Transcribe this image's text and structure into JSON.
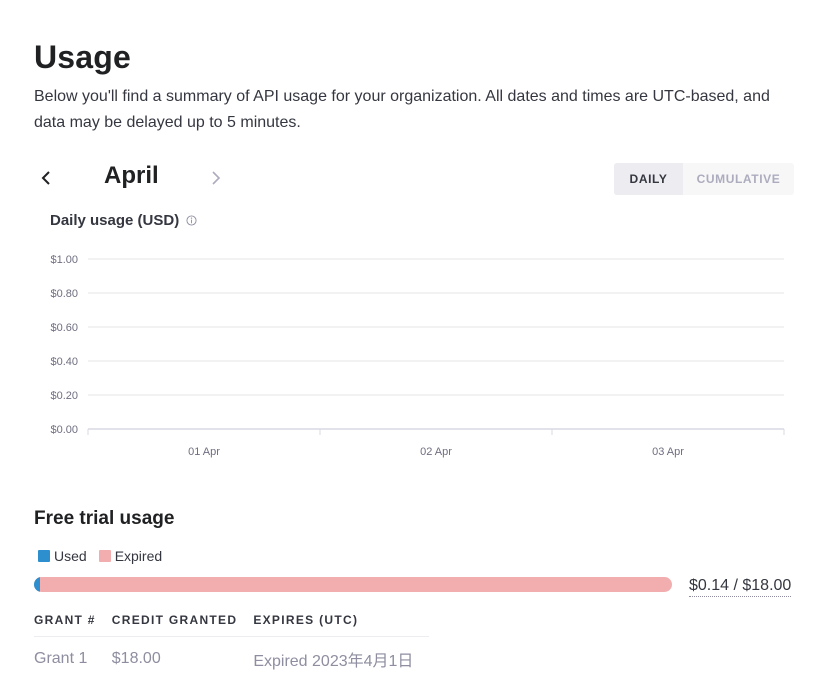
{
  "page": {
    "title": "Usage",
    "intro": "Below you'll find a summary of API usage for your organization. All dates and times are UTC-based, and data may be delayed up to 5 minutes."
  },
  "month_nav": {
    "month": "April",
    "prev_icon": "chevron-left-icon",
    "next_icon": "chevron-right-icon"
  },
  "view_toggle": {
    "daily": "DAILY",
    "cumulative": "CUMULATIVE",
    "selected": "DAILY"
  },
  "chart_data": {
    "type": "bar",
    "title": "Daily usage (USD)",
    "categories": [
      "01 Apr",
      "02 Apr",
      "03 Apr"
    ],
    "values": [
      0,
      0,
      0
    ],
    "ylim": [
      0,
      1.0
    ],
    "yticks": [
      "$0.00",
      "$0.20",
      "$0.40",
      "$0.60",
      "$0.80",
      "$1.00"
    ],
    "ytick_values": [
      0,
      0.2,
      0.4,
      0.6,
      0.8,
      1.0
    ],
    "grid": true
  },
  "free_trial": {
    "title": "Free trial usage",
    "legend": [
      {
        "label": "Used",
        "color": "#2d8fce"
      },
      {
        "label": "Expired",
        "color": "#f2aeaf"
      }
    ],
    "used_amount": 0.14,
    "total_amount": 18.0,
    "total_text": "$0.14 / $18.00"
  },
  "grants": {
    "columns": [
      "GRANT #",
      "CREDIT GRANTED",
      "EXPIRES (UTC)"
    ],
    "rows": [
      [
        "Grant 1",
        "$18.00",
        "Expired 2023年4月1日"
      ]
    ]
  },
  "colors": {
    "used": "#2d8fce",
    "expired": "#f2aeaf",
    "grid": "#e5e5e5"
  }
}
